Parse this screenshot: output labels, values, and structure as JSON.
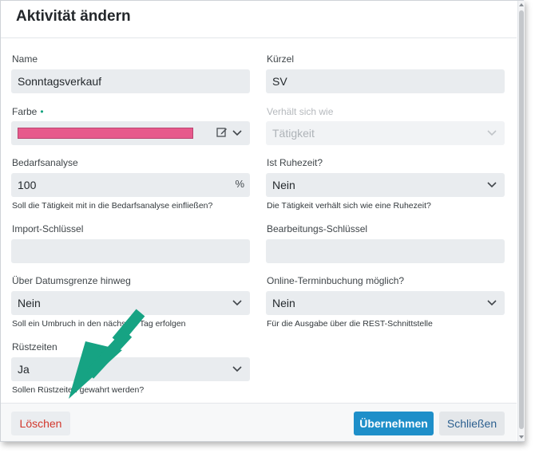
{
  "dialog": {
    "title": "Aktivität ändern"
  },
  "form": {
    "name": {
      "label": "Name",
      "value": "Sonntagsverkauf"
    },
    "kuerzel": {
      "label": "Kürzel",
      "value": "SV"
    },
    "farbe": {
      "label": "Farbe",
      "required_marker": "•",
      "color": "#e75a8c"
    },
    "verhaelt": {
      "label": "Verhält sich wie",
      "value": "Tätigkeit"
    },
    "bedarf": {
      "label": "Bedarfsanalyse",
      "value": "100",
      "unit": "%",
      "hint": "Soll die Tätigkeit mit in die Bedarfsanalyse einfließen?"
    },
    "ruhezeit": {
      "label": "Ist Ruhezeit?",
      "value": "Nein",
      "hint": "Die Tätigkeit verhält sich wie eine Ruhezeit?"
    },
    "import": {
      "label": "Import-Schlüssel",
      "value": ""
    },
    "bearbeitung": {
      "label": "Bearbeitungs-Schlüssel",
      "value": ""
    },
    "datumsgrenze": {
      "label": "Über Datumsgrenze hinweg",
      "value": "Nein",
      "hint": "Soll ein Umbruch in den nächsten Tag erfolgen"
    },
    "online": {
      "label": "Online-Terminbuchung möglich?",
      "value": "Nein",
      "hint": "Für die Ausgabe über die REST-Schnittstelle"
    },
    "ruest": {
      "label": "Rüstzeiten",
      "value": "Ja",
      "hint": "Sollen Rüstzeiten gewahrt werden?"
    }
  },
  "footer": {
    "delete_label": "Löschen",
    "apply_label": "Übernehmen",
    "close_label": "Schließen"
  },
  "colors": {
    "accent": "#1e8fc9",
    "danger": "#d2372c",
    "required": "#14a37f",
    "annotation_arrow": "#16a383"
  }
}
